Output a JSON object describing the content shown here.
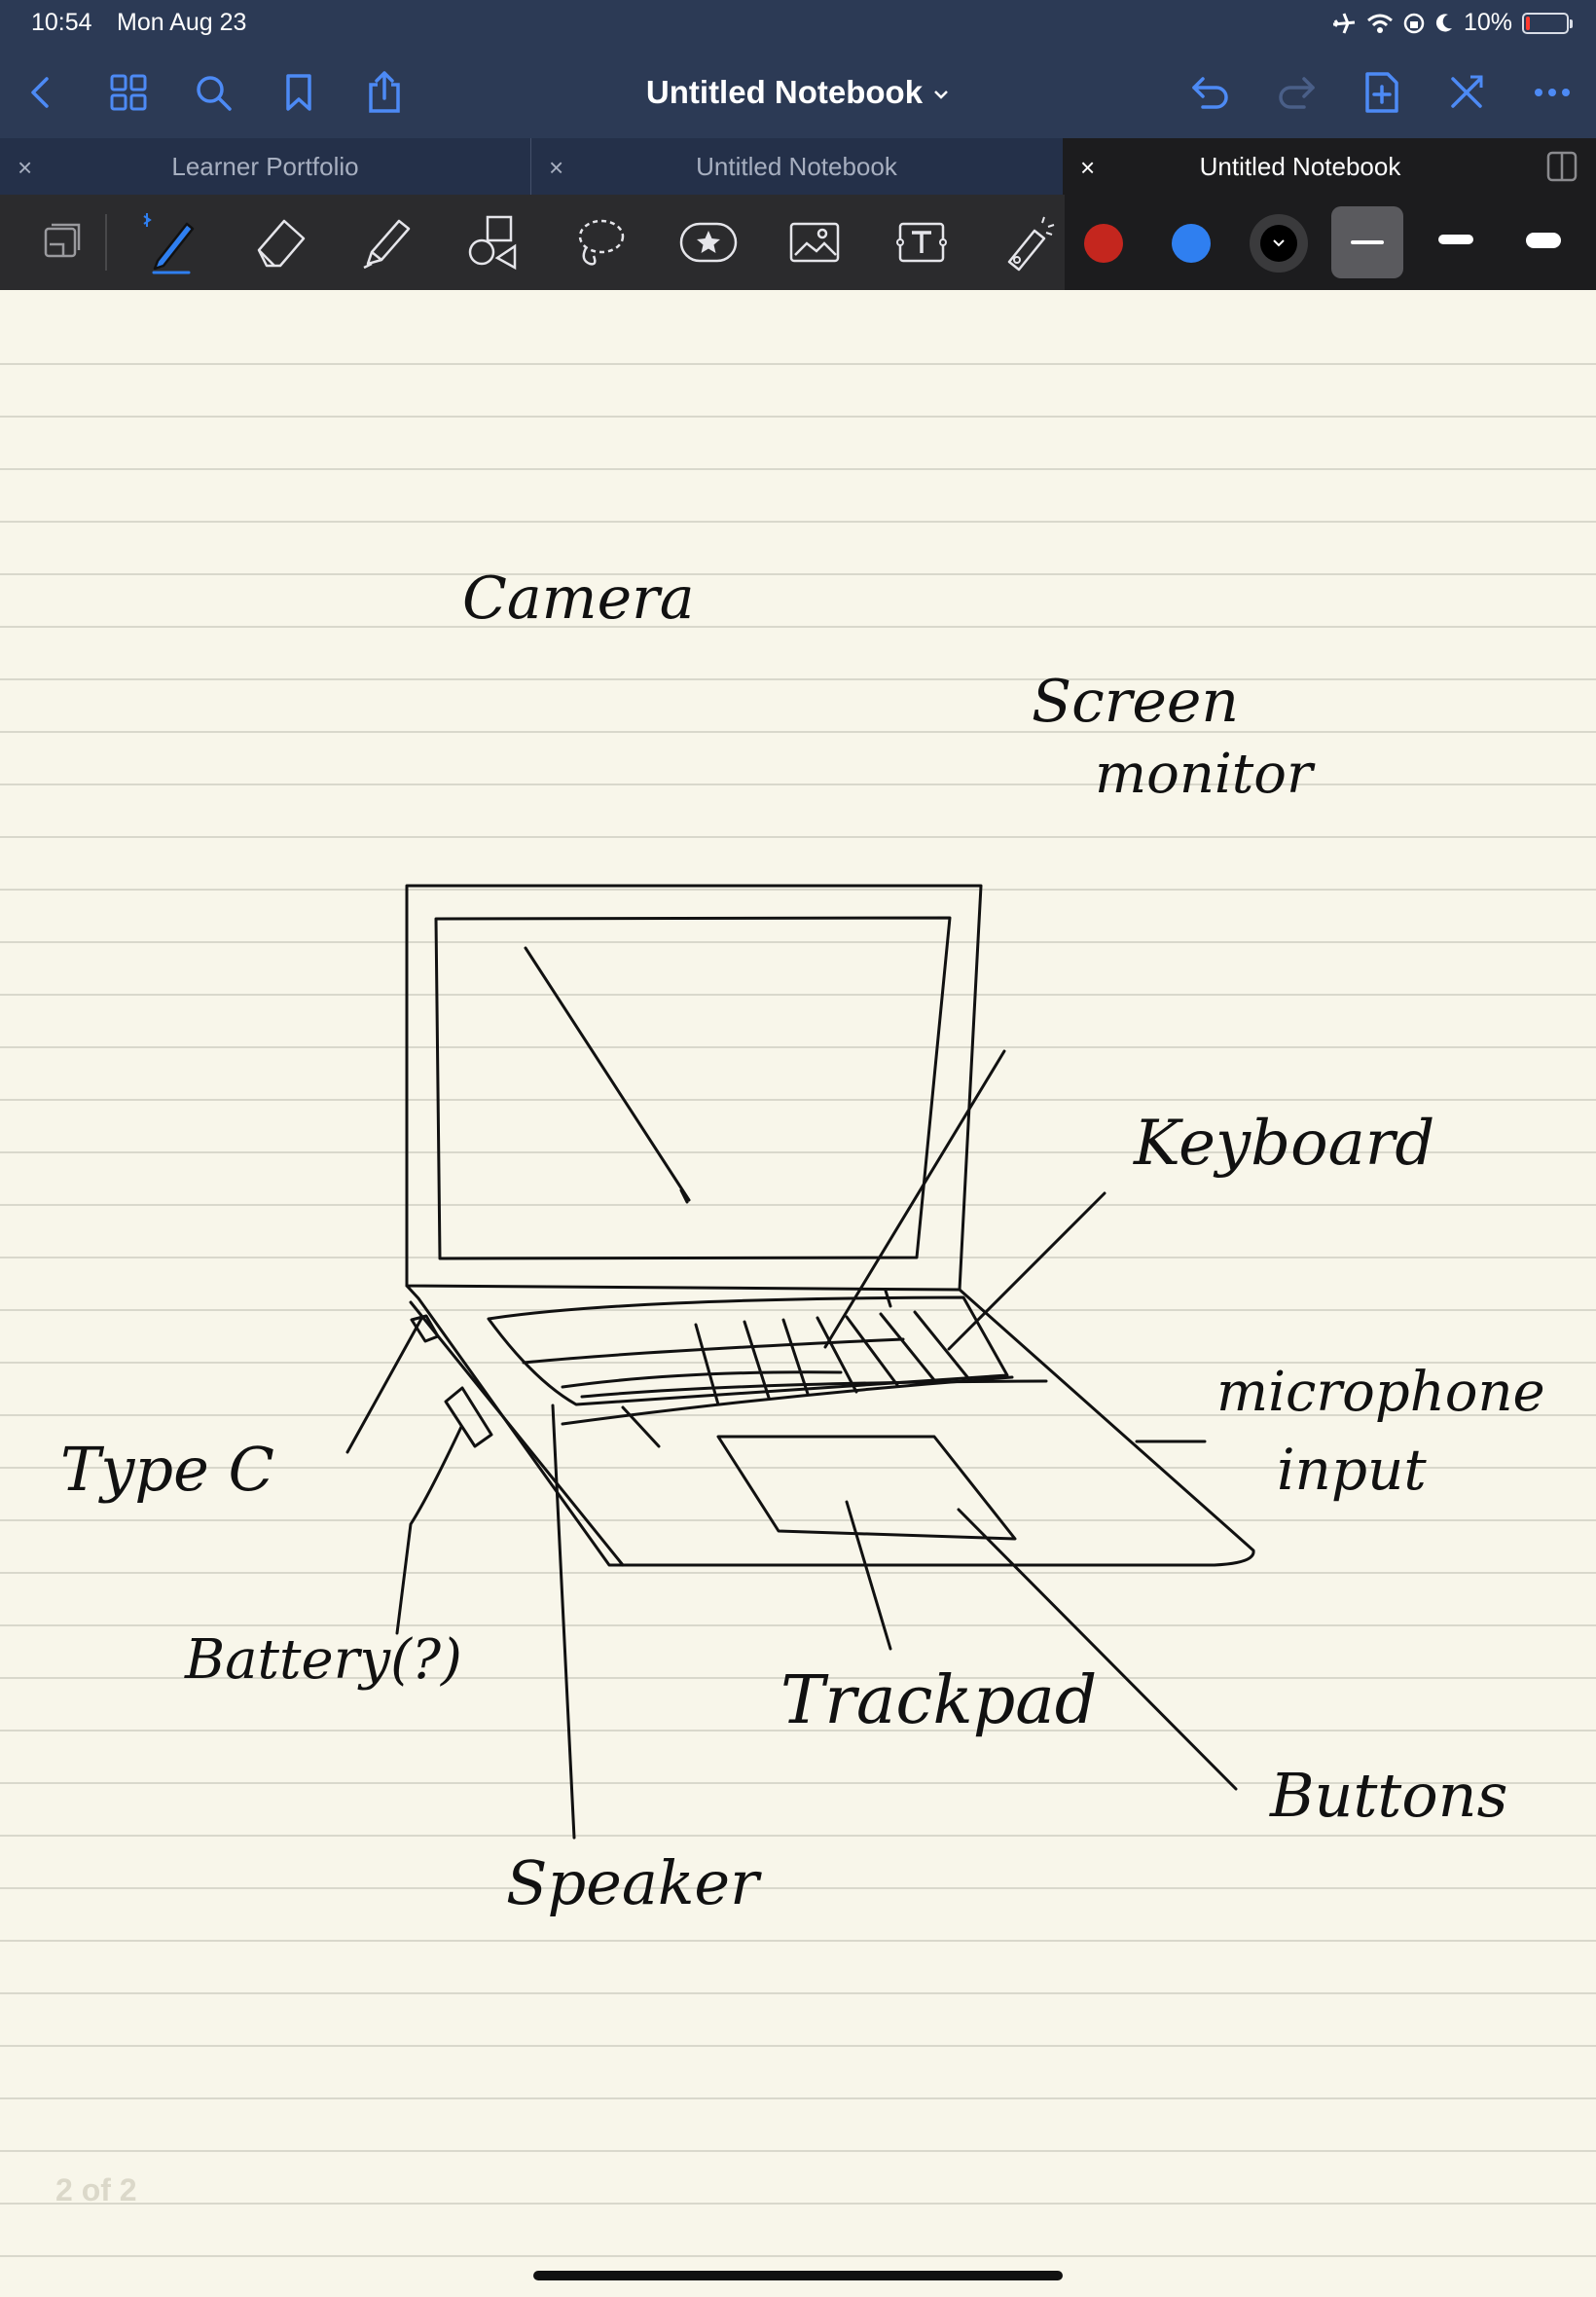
{
  "status_bar": {
    "time": "10:54",
    "date": "Mon Aug 23",
    "battery_percent": "10%",
    "battery_level": 0.1
  },
  "nav": {
    "title": "Untitled Notebook",
    "icons": [
      "back-chevron-icon",
      "grid-icon",
      "search-icon",
      "bookmark-icon",
      "share-icon",
      "undo-icon",
      "redo-icon",
      "add-page-icon",
      "close-x-icon",
      "more-icon"
    ]
  },
  "tabs": [
    {
      "label": "Learner Portfolio",
      "close": "×",
      "active": false
    },
    {
      "label": "Untitled Notebook",
      "close": "×",
      "active": false
    },
    {
      "label": "Untitled Notebook",
      "close": "×",
      "active": true
    }
  ],
  "toolbar": {
    "tools": [
      "page-view-icon",
      "pen-icon",
      "eraser-icon",
      "highlighter-icon",
      "shapes-icon",
      "lasso-icon",
      "sticker-icon",
      "image-icon",
      "text-icon",
      "laser-pointer-icon"
    ],
    "selected_tool": "pen-icon",
    "colors": [
      "#c4261e",
      "#2f7ff0",
      "#000000"
    ],
    "selected_stroke": "thin"
  },
  "notes": {
    "camera": "Camera",
    "screen": "Screen",
    "monitor": "monitor",
    "keyboard": "Keyboard",
    "microphone": "microphone",
    "input": "input",
    "typec": "Type C",
    "battery": "Battery(?)",
    "trackpad": "Trackpad",
    "buttons": "Buttons",
    "speaker": "Speaker"
  },
  "page_indicator": "2 of 2"
}
